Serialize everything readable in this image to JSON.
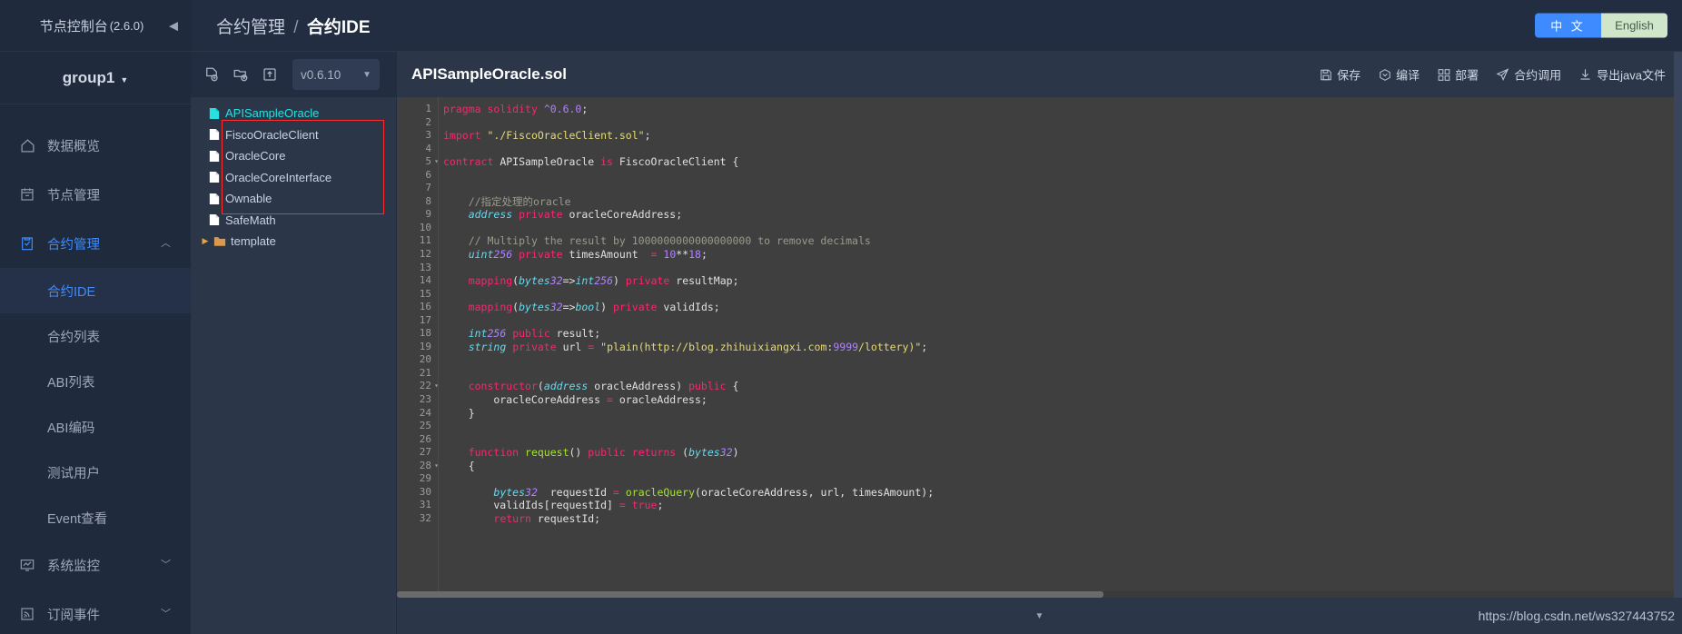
{
  "sidebar": {
    "title": "节点控制台",
    "version": "(2.6.0)",
    "collapse_icon": "chevron-left-icon",
    "group": {
      "label": "group1",
      "caret": "▼"
    },
    "items": [
      {
        "label": "数据概览",
        "icon": "home-icon",
        "arrow": ""
      },
      {
        "label": "节点管理",
        "icon": "calendar-icon",
        "arrow": ""
      },
      {
        "label": "合约管理",
        "icon": "clipboard-check-icon",
        "arrow": "︿",
        "active": true
      }
    ],
    "sub_items": [
      {
        "label": "合约IDE",
        "selected": true
      },
      {
        "label": "合约列表",
        "selected": false
      },
      {
        "label": "ABI列表",
        "selected": false
      },
      {
        "label": "ABI编码",
        "selected": false
      },
      {
        "label": "测试用户",
        "selected": false
      },
      {
        "label": "Event查看",
        "selected": false
      }
    ],
    "items_bottom": [
      {
        "label": "系统监控",
        "icon": "monitor-chart-icon",
        "arrow": "﹀"
      },
      {
        "label": "订阅事件",
        "icon": "rss-icon",
        "arrow": "﹀"
      }
    ]
  },
  "topbar": {
    "breadcrumb_parent": "合约管理",
    "breadcrumb_sep": "/",
    "breadcrumb_current": "合约IDE",
    "lang_cn": "中 文",
    "lang_en": "English"
  },
  "file_panel": {
    "toolbar_icons": [
      "new-file-icon",
      "new-folder-icon",
      "upload-icon"
    ],
    "version_select": {
      "value": "v0.6.10",
      "caret": "chevron-down-icon"
    },
    "tree": [
      {
        "name": "APISampleOracle",
        "type": "file",
        "selected": true,
        "level": 2
      },
      {
        "name": "FiscoOracleClient",
        "type": "file",
        "selected": false,
        "level": 2
      },
      {
        "name": "OracleCore",
        "type": "file",
        "selected": false,
        "level": 2
      },
      {
        "name": "OracleCoreInterface",
        "type": "file",
        "selected": false,
        "level": 2
      },
      {
        "name": "Ownable",
        "type": "file",
        "selected": false,
        "level": 2
      },
      {
        "name": "SafeMath",
        "type": "file",
        "selected": false,
        "level": 2
      },
      {
        "name": "template",
        "type": "folder",
        "selected": false,
        "level": 1,
        "twisty": "▶"
      }
    ],
    "highlight_color": "#ff2d2d"
  },
  "editor": {
    "filename": "APISampleOracle.sol",
    "actions": [
      {
        "label": "保存",
        "icon": "save-icon"
      },
      {
        "label": "编译",
        "icon": "compile-hex-icon"
      },
      {
        "label": "部署",
        "icon": "deploy-grid-icon"
      },
      {
        "label": "合约调用",
        "icon": "send-plane-icon"
      },
      {
        "label": "导出java文件",
        "icon": "download-icon"
      }
    ],
    "line_numbers": [
      1,
      2,
      3,
      4,
      5,
      6,
      7,
      8,
      9,
      10,
      11,
      12,
      13,
      14,
      15,
      16,
      17,
      18,
      19,
      20,
      21,
      22,
      23,
      24,
      25,
      26,
      27,
      28,
      29,
      30,
      31,
      32
    ],
    "fold_lines": [
      5,
      22,
      28
    ],
    "lines": [
      "pragma solidity ^0.6.0;",
      "",
      "import \"./FiscoOracleClient.sol\";",
      "",
      "contract APISampleOracle is FiscoOracleClient {",
      "",
      "",
      "    //指定处理的oracle",
      "    address private oracleCoreAddress;",
      "",
      "    // Multiply the result by 1000000000000000000 to remove decimals",
      "    uint256 private timesAmount  = 10**18;",
      "",
      "    mapping(bytes32=>int256) private resultMap;",
      "",
      "    mapping(bytes32=>bool) private validIds;",
      "",
      "    int256 public result;",
      "    string private url = \"plain(http://blog.zhihuixiangxi.com:9999/lottery)\";",
      "",
      "",
      "    constructor(address oracleAddress) public {",
      "        oracleCoreAddress = oracleAddress;",
      "    }",
      "",
      "",
      "    function request() public returns (bytes32)",
      "    {",
      "",
      "        bytes32  requestId = oracleQuery(oracleCoreAddress, url, timesAmount);",
      "        validIds[requestId] = true;",
      "        return requestId;"
    ],
    "footer_caret": "▼",
    "watermark": "https://blog.csdn.net/ws327443752"
  },
  "colors": {
    "sidebar_bg": "#1f2a3c",
    "panel_bg": "#2b3648",
    "topbar_bg": "#222d41",
    "accent_blue": "#3e8bff",
    "code_bg": "#3f3f3f",
    "selected_file": "#28e0e0",
    "highlight_red": "#ff2d2d",
    "lang_en_bg": "#cfe6ca"
  }
}
